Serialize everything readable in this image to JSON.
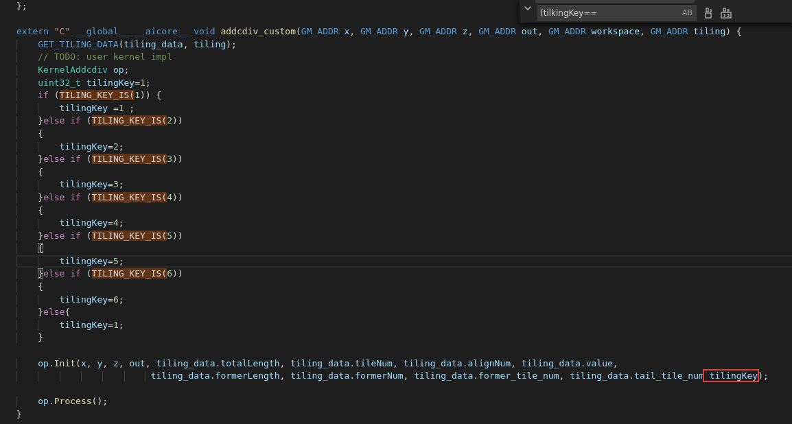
{
  "editor": {
    "lines": [
      {
        "kind": "code",
        "tokens": [
          {
            "text": "};",
            "kind": "plain"
          }
        ]
      },
      {
        "kind": "blank"
      },
      {
        "kind": "code",
        "tokens": [
          {
            "text": "extern ",
            "kind": "keyword"
          },
          {
            "text": "\"C\" ",
            "kind": "string"
          },
          {
            "text": "__global__ __aicore__ void ",
            "kind": "keyword"
          },
          {
            "text": "addcdiv_custom",
            "kind": "function"
          },
          {
            "text": "(",
            "kind": "plain"
          },
          {
            "text": "GM_ADDR ",
            "kind": "keyword"
          },
          {
            "text": "x",
            "kind": "variable"
          },
          {
            "text": ", ",
            "kind": "plain"
          },
          {
            "text": "GM_ADDR ",
            "kind": "keyword"
          },
          {
            "text": "y",
            "kind": "variable"
          },
          {
            "text": ", ",
            "kind": "plain"
          },
          {
            "text": "GM_ADDR ",
            "kind": "keyword"
          },
          {
            "text": "z",
            "kind": "variable"
          },
          {
            "text": ", ",
            "kind": "plain"
          },
          {
            "text": "GM_ADDR ",
            "kind": "keyword"
          },
          {
            "text": "out",
            "kind": "variable"
          },
          {
            "text": ", ",
            "kind": "plain"
          },
          {
            "text": "GM_ADDR ",
            "kind": "keyword"
          },
          {
            "text": "workspace",
            "kind": "variable"
          },
          {
            "text": ", ",
            "kind": "plain"
          },
          {
            "text": "GM_ADDR ",
            "kind": "keyword"
          },
          {
            "text": "tiling",
            "kind": "variable"
          },
          {
            "text": ") {",
            "kind": "plain"
          }
        ]
      },
      {
        "kind": "code",
        "tokens": [
          {
            "text": "    GET_TILING_DATA",
            "kind": "keyword"
          },
          {
            "text": "(",
            "kind": "plain"
          },
          {
            "text": "tiling_data",
            "kind": "variable"
          },
          {
            "text": ", ",
            "kind": "plain"
          },
          {
            "text": "tiling",
            "kind": "variable"
          },
          {
            "text": ");",
            "kind": "plain"
          }
        ]
      },
      {
        "kind": "code",
        "tokens": [
          {
            "text": "    // TODO: user kernel impl",
            "kind": "comment"
          }
        ]
      },
      {
        "kind": "code",
        "tokens": [
          {
            "text": "    KernelAddcdiv ",
            "kind": "type"
          },
          {
            "text": "op",
            "kind": "variable"
          },
          {
            "text": ";",
            "kind": "plain"
          }
        ]
      },
      {
        "kind": "code",
        "tokens": [
          {
            "text": "    uint32_t ",
            "kind": "type"
          },
          {
            "text": "tilingKey",
            "kind": "variable"
          },
          {
            "text": "=",
            "kind": "plain"
          },
          {
            "text": "1",
            "kind": "number"
          },
          {
            "text": ";",
            "kind": "plain"
          }
        ]
      },
      {
        "kind": "code",
        "tokens": [
          {
            "text": "    if ",
            "kind": "control"
          },
          {
            "text": "(",
            "kind": "plain"
          },
          {
            "text": "TILING_KEY_IS(",
            "kind": "plain",
            "match": true
          },
          {
            "text": "1",
            "kind": "number"
          },
          {
            "text": ")) {",
            "kind": "plain"
          }
        ]
      },
      {
        "kind": "code",
        "tokens": [
          {
            "text": "        tilingKey ",
            "kind": "variable"
          },
          {
            "text": "=",
            "kind": "plain"
          },
          {
            "text": "1",
            "kind": "number"
          },
          {
            "text": " ;",
            "kind": "plain"
          }
        ]
      },
      {
        "kind": "code",
        "tokens": [
          {
            "text": "    }",
            "kind": "plain"
          },
          {
            "text": "else if ",
            "kind": "control"
          },
          {
            "text": "(",
            "kind": "plain"
          },
          {
            "text": "TILING_KEY_IS(",
            "kind": "plain",
            "match": true
          },
          {
            "text": "2",
            "kind": "number"
          },
          {
            "text": "))",
            "kind": "plain"
          }
        ]
      },
      {
        "kind": "code",
        "tokens": [
          {
            "text": "    {",
            "kind": "plain"
          }
        ]
      },
      {
        "kind": "code",
        "tokens": [
          {
            "text": "        tilingKey",
            "kind": "variable"
          },
          {
            "text": "=",
            "kind": "plain"
          },
          {
            "text": "2",
            "kind": "number"
          },
          {
            "text": ";",
            "kind": "plain"
          }
        ]
      },
      {
        "kind": "code",
        "tokens": [
          {
            "text": "    }",
            "kind": "plain"
          },
          {
            "text": "else if ",
            "kind": "control"
          },
          {
            "text": "(",
            "kind": "plain"
          },
          {
            "text": "TILING_KEY_IS(",
            "kind": "plain",
            "match": true
          },
          {
            "text": "3",
            "kind": "number"
          },
          {
            "text": "))",
            "kind": "plain"
          }
        ]
      },
      {
        "kind": "code",
        "tokens": [
          {
            "text": "    {",
            "kind": "plain"
          }
        ]
      },
      {
        "kind": "code",
        "tokens": [
          {
            "text": "        tilingKey",
            "kind": "variable"
          },
          {
            "text": "=",
            "kind": "plain"
          },
          {
            "text": "3",
            "kind": "number"
          },
          {
            "text": ";",
            "kind": "plain"
          }
        ]
      },
      {
        "kind": "code",
        "tokens": [
          {
            "text": "    }",
            "kind": "plain"
          },
          {
            "text": "else if ",
            "kind": "control"
          },
          {
            "text": "(",
            "kind": "plain"
          },
          {
            "text": "TILING_KEY_IS(",
            "kind": "plain",
            "match": true
          },
          {
            "text": "4",
            "kind": "number"
          },
          {
            "text": "))",
            "kind": "plain"
          }
        ]
      },
      {
        "kind": "code",
        "tokens": [
          {
            "text": "    {",
            "kind": "plain"
          }
        ]
      },
      {
        "kind": "code",
        "tokens": [
          {
            "text": "        tilingKey",
            "kind": "variable"
          },
          {
            "text": "=",
            "kind": "plain"
          },
          {
            "text": "4",
            "kind": "number"
          },
          {
            "text": ";",
            "kind": "plain"
          }
        ]
      },
      {
        "kind": "code",
        "tokens": [
          {
            "text": "    }",
            "kind": "plain"
          },
          {
            "text": "else if ",
            "kind": "control"
          },
          {
            "text": "(",
            "kind": "plain"
          },
          {
            "text": "TILING_KEY_IS(",
            "kind": "plain",
            "match": true
          },
          {
            "text": "5",
            "kind": "number"
          },
          {
            "text": "))",
            "kind": "plain"
          }
        ]
      },
      {
        "kind": "code",
        "tokens": [
          {
            "text": "    {",
            "kind": "plain",
            "bracket_match": true
          }
        ]
      },
      {
        "kind": "code",
        "current": true,
        "tokens": [
          {
            "text": "        tilingKey",
            "kind": "variable"
          },
          {
            "text": "=",
            "kind": "plain"
          },
          {
            "text": "5",
            "kind": "number"
          },
          {
            "text": ";",
            "kind": "plain"
          }
        ]
      },
      {
        "kind": "code",
        "tokens": [
          {
            "text": "    }",
            "kind": "plain",
            "bracket_match": true
          },
          {
            "text": "else if ",
            "kind": "control"
          },
          {
            "text": "(",
            "kind": "plain"
          },
          {
            "text": "TILING_KEY_IS(",
            "kind": "plain",
            "match": true
          },
          {
            "text": "6",
            "kind": "number"
          },
          {
            "text": "))",
            "kind": "plain"
          }
        ]
      },
      {
        "kind": "code",
        "tokens": [
          {
            "text": "    {",
            "kind": "plain"
          }
        ]
      },
      {
        "kind": "code",
        "tokens": [
          {
            "text": "        tilingKey",
            "kind": "variable"
          },
          {
            "text": "=",
            "kind": "plain"
          },
          {
            "text": "6",
            "kind": "number"
          },
          {
            "text": ";",
            "kind": "plain"
          }
        ]
      },
      {
        "kind": "code",
        "tokens": [
          {
            "text": "    }",
            "kind": "plain"
          },
          {
            "text": "else",
            "kind": "control"
          },
          {
            "text": "{",
            "kind": "plain"
          }
        ]
      },
      {
        "kind": "code",
        "tokens": [
          {
            "text": "        tilingKey",
            "kind": "variable"
          },
          {
            "text": "=",
            "kind": "plain"
          },
          {
            "text": "1",
            "kind": "number"
          },
          {
            "text": ";",
            "kind": "plain"
          }
        ]
      },
      {
        "kind": "code",
        "tokens": [
          {
            "text": "    }",
            "kind": "plain"
          }
        ]
      },
      {
        "kind": "blank"
      },
      {
        "kind": "code",
        "tokens": [
          {
            "text": "    op",
            "kind": "variable"
          },
          {
            "text": ".",
            "kind": "plain"
          },
          {
            "text": "Init",
            "kind": "function"
          },
          {
            "text": "(",
            "kind": "plain"
          },
          {
            "text": "x",
            "kind": "variable"
          },
          {
            "text": ", ",
            "kind": "plain"
          },
          {
            "text": "y",
            "kind": "variable"
          },
          {
            "text": ", ",
            "kind": "plain"
          },
          {
            "text": "z",
            "kind": "variable"
          },
          {
            "text": ", ",
            "kind": "plain"
          },
          {
            "text": "out",
            "kind": "variable"
          },
          {
            "text": ", ",
            "kind": "plain"
          },
          {
            "text": "tiling_data.totalLength",
            "kind": "variable"
          },
          {
            "text": ", ",
            "kind": "plain"
          },
          {
            "text": "tiling_data.tileNum",
            "kind": "variable"
          },
          {
            "text": ", ",
            "kind": "plain"
          },
          {
            "text": "tiling_data.alignNum",
            "kind": "variable"
          },
          {
            "text": ", ",
            "kind": "plain"
          },
          {
            "text": "tiling_data.value",
            "kind": "variable"
          },
          {
            "text": ",",
            "kind": "plain"
          }
        ]
      },
      {
        "kind": "code",
        "tokens": [
          {
            "text": "                         tiling_data.formerLength",
            "kind": "variable"
          },
          {
            "text": ", ",
            "kind": "plain"
          },
          {
            "text": "tiling_data.formerNum",
            "kind": "variable"
          },
          {
            "text": ", ",
            "kind": "plain"
          },
          {
            "text": "tiling_data.former_tile_num",
            "kind": "variable"
          },
          {
            "text": ", ",
            "kind": "plain"
          },
          {
            "text": "tiling_data.tail_tile_num",
            "kind": "variable"
          },
          {
            "text": " tilingKey",
            "kind": "variable",
            "boxed": true
          },
          {
            "text": ");",
            "kind": "plain"
          }
        ]
      },
      {
        "kind": "blank"
      },
      {
        "kind": "code",
        "tokens": [
          {
            "text": "    op",
            "kind": "variable"
          },
          {
            "text": ".",
            "kind": "plain"
          },
          {
            "text": "Process",
            "kind": "function"
          },
          {
            "text": "();",
            "kind": "plain"
          }
        ]
      },
      {
        "kind": "code",
        "tokens": [
          {
            "text": "}",
            "kind": "plain"
          }
        ]
      }
    ]
  },
  "find_widget": {
    "replace_value": "(tilkingKey==",
    "toggle_label": "AB"
  }
}
